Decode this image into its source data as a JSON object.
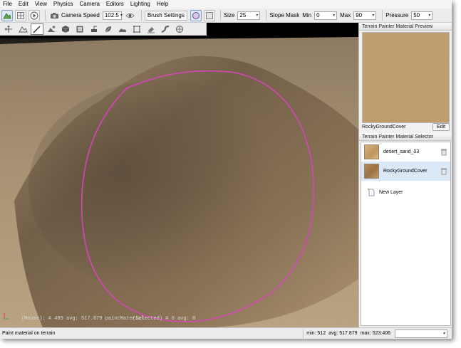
{
  "menubar": {
    "items": [
      "File",
      "Edit",
      "View",
      "Physics",
      "Camera",
      "Editors",
      "Lighting",
      "Help"
    ]
  },
  "toolbar": {
    "camera_speed_label": "Camera Speed",
    "camera_speed_value": "102.5",
    "brush_settings_label": "Brush Settings",
    "size_label": "Size",
    "size_value": "25",
    "slope_mask_label": "Slope Mask",
    "min_label": "Min",
    "min_value": "0",
    "max_label": "Max",
    "max_value": "90",
    "pressure_label": "Pressure",
    "pressure_value": "50"
  },
  "viewport": {
    "mouse_readout": "(Mouse): # 489  avg: 517.879  paintMaterial",
    "selected_readout": "(Selected) # 0  avg: 0"
  },
  "preview_panel": {
    "title": "Terrain Painter Material Preview",
    "material_name": "RockyGroundCover",
    "edit_label": "Edit"
  },
  "selector_panel": {
    "title": "Terrain Painter Material Selector",
    "layers": [
      {
        "name": "desert_sand_03"
      },
      {
        "name": "RockyGroundCover"
      }
    ],
    "new_layer_label": "New Layer"
  },
  "statusbar": {
    "message": "Paint material on terrain",
    "min": "min: 512",
    "avg": "avg: 517.879",
    "max": "max: 523.406"
  },
  "colors": {
    "brush_ring": "#d447b8",
    "sky": "#000000",
    "sand": "#b89a72",
    "rock": "#7a6247",
    "selected_row": "#dbe8f6"
  },
  "icons": {
    "toolbar": [
      "terrain-editor-icon",
      "grid-icon",
      "play-icon",
      "camera-icon",
      "eye-icon",
      "brush-circle-icon",
      "brush-square-icon"
    ],
    "tools": [
      "select-arrows-icon",
      "mountain-icon",
      "paint-brush-icon",
      "mountain-sun-icon",
      "cube-icon",
      "texture-icon",
      "crane-icon",
      "leaf-icon",
      "landscape-icon",
      "box-icon",
      "eraser-icon",
      "road-icon",
      "river-icon"
    ]
  }
}
